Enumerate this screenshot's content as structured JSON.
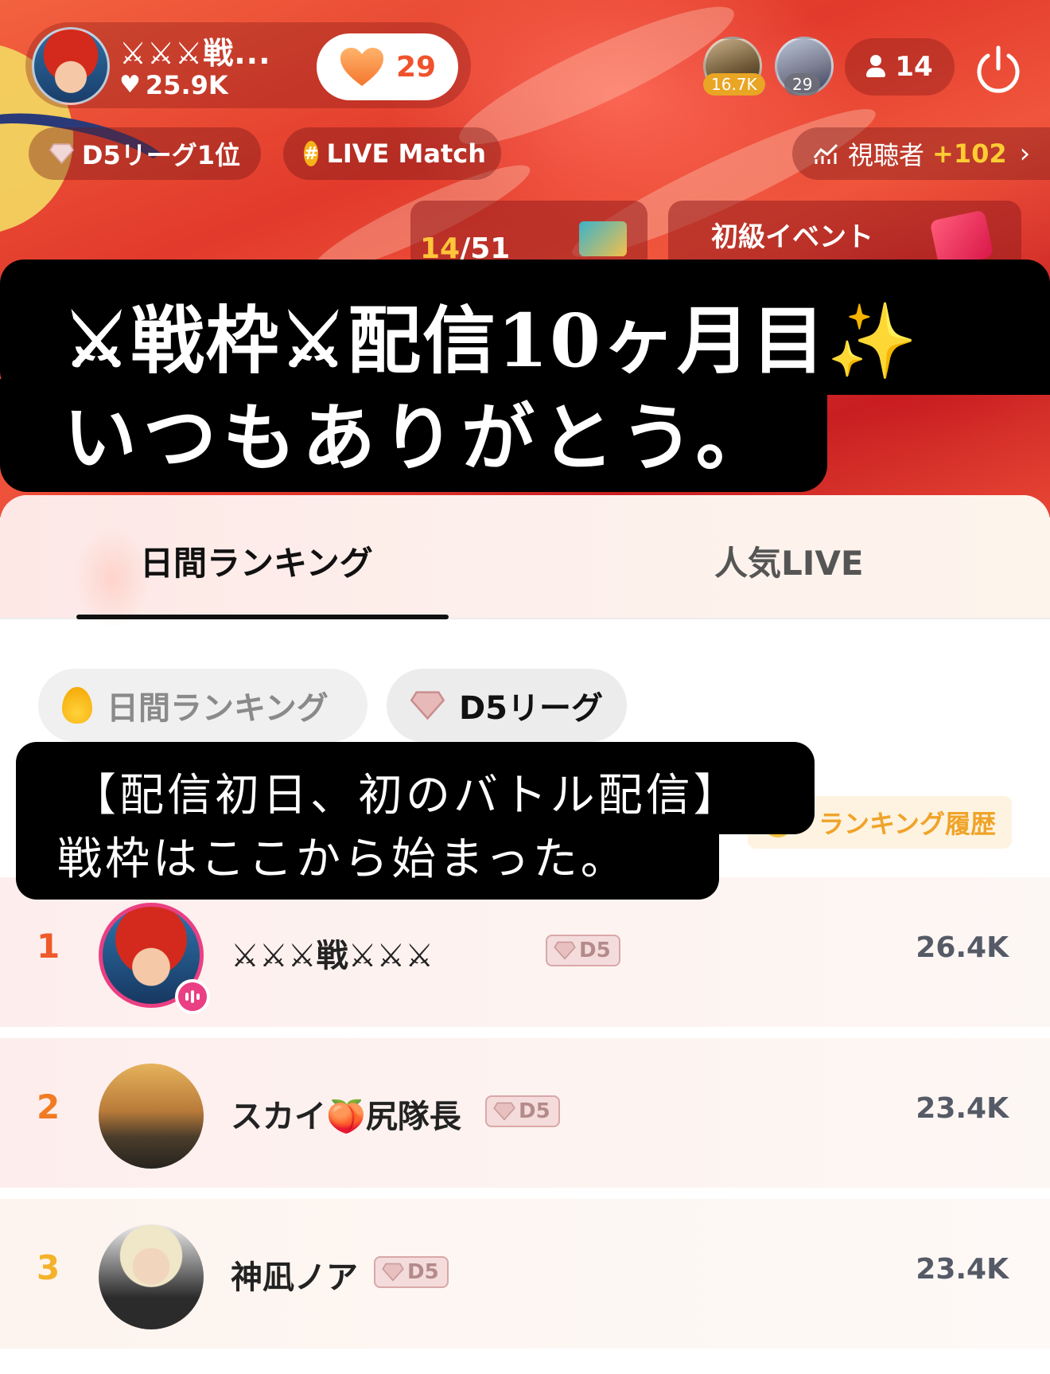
{
  "header": {
    "host_name": "⚔⚔⚔戦...",
    "host_likes": "25.9K",
    "heart_count": "29",
    "viewer_badges": [
      "16.7K",
      "29"
    ],
    "viewer_count": "14",
    "league_chip": "D5リーグ1位",
    "match_chip": "LIVE Match",
    "viewers_chip": {
      "label": "視聴者",
      "delta": "+102"
    },
    "event_progress": {
      "current": "14",
      "total": "/51"
    },
    "event_title": "初級イベント"
  },
  "caption_main": {
    "line1": "⚔戦枠⚔配信10ヶ月目✨",
    "line2": "いつもありがとう。"
  },
  "tabs": {
    "daily": "日間ランキング",
    "popular": "人気LIVE"
  },
  "subtabs": {
    "daily": "日間ランキング",
    "league": "D5リーグ"
  },
  "history_label": "ランキング履歴",
  "caption_small": {
    "line1": "【配信初日、初のバトル配信】",
    "line2": "戦枠はここから始まった。"
  },
  "ranking": [
    {
      "rank": "1",
      "name": "⚔⚔⚔戦⚔⚔⚔",
      "league": "D5",
      "score": "26.4K"
    },
    {
      "rank": "2",
      "name": "スカイ🍑尻隊長",
      "league": "D5",
      "score": "23.4K"
    },
    {
      "rank": "3",
      "name": "神凪ノア",
      "league": "D5",
      "score": "23.4K"
    }
  ],
  "colors": {
    "accent": "#f0532c",
    "live_pink": "#ea3f82",
    "gold": "#f0a329"
  }
}
